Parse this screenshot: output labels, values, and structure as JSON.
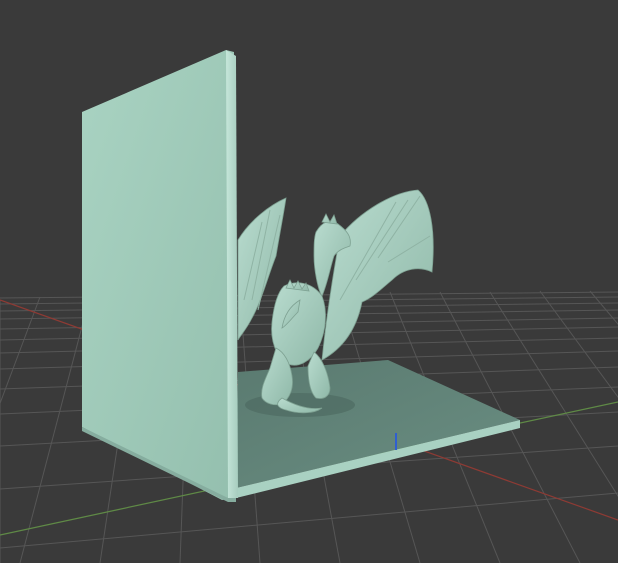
{
  "viewport": {
    "background_color": "#3a3a3a",
    "grid_color": "#555555",
    "x_axis_color": "#c0392b",
    "y_axis_color": "#6aa84f",
    "z_axis_color": "#2f5fd0"
  },
  "model": {
    "material_color": "#9ec9b8",
    "shadow_color": "#5d7d73",
    "parts": [
      "bookend-base",
      "bookend-back-wall",
      "dragon-sculpture"
    ]
  }
}
